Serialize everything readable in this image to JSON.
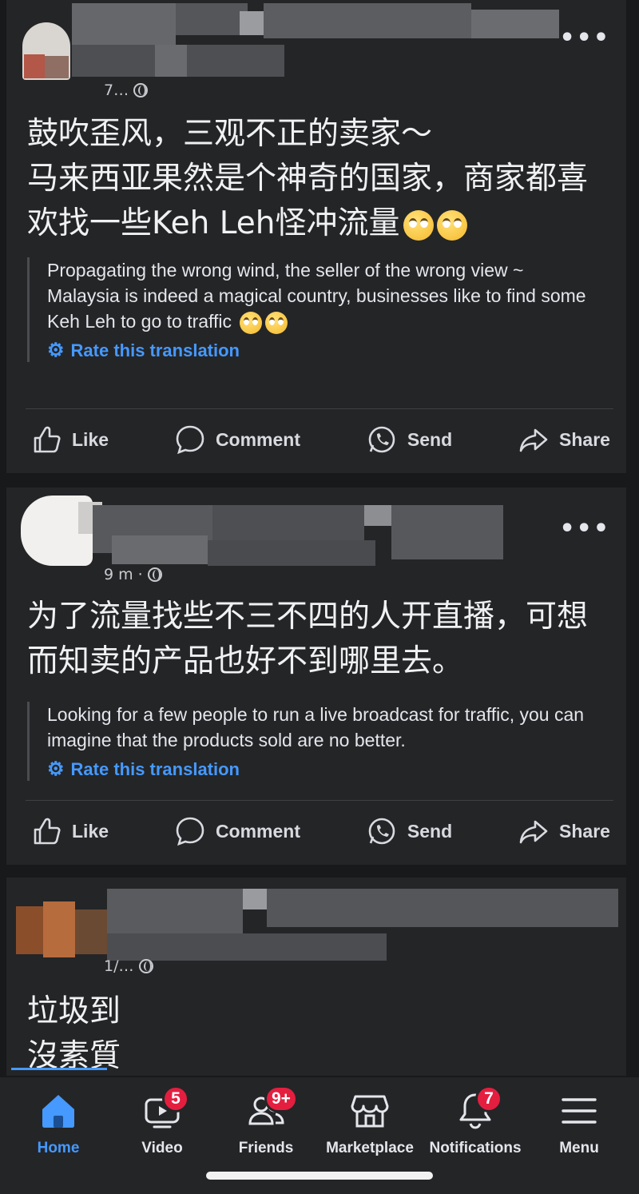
{
  "posts": [
    {
      "meta": "7…",
      "original_text": "鼓吹歪风，三观不正的卖家～\n马来西亚果然是个神奇的国家，商家都喜欢找一些Keh Leh怪冲流量",
      "translation": "Propagating the wrong wind, the seller of the wrong view ~\nMalaysia is indeed a magical country, businesses like to find some Keh Leh to go to traffic",
      "rate_label": "Rate this translation"
    },
    {
      "meta": "9 m ·",
      "original_text": "为了流量找些不三不四的人开直播，可想而知卖的产品也好不到哪里去。",
      "translation": "Looking for a few people to run a live broadcast for traffic, you can imagine that the products sold are no better.",
      "rate_label": "Rate this translation"
    },
    {
      "meta": "1/…",
      "original_text": "垃圾到\n沒素質"
    }
  ],
  "actions": {
    "like": "Like",
    "comment": "Comment",
    "send": "Send",
    "share": "Share"
  },
  "more": "•••",
  "nav": {
    "home": "Home",
    "video": "Video",
    "video_badge": "5",
    "friends": "Friends",
    "friends_badge": "9+",
    "marketplace": "Marketplace",
    "notifications": "Notifications",
    "notifications_badge": "7",
    "menu": "Menu"
  },
  "colors": {
    "background": "#18191b",
    "card": "#242527",
    "accent": "#4599ff",
    "badge": "#e41e3f"
  }
}
